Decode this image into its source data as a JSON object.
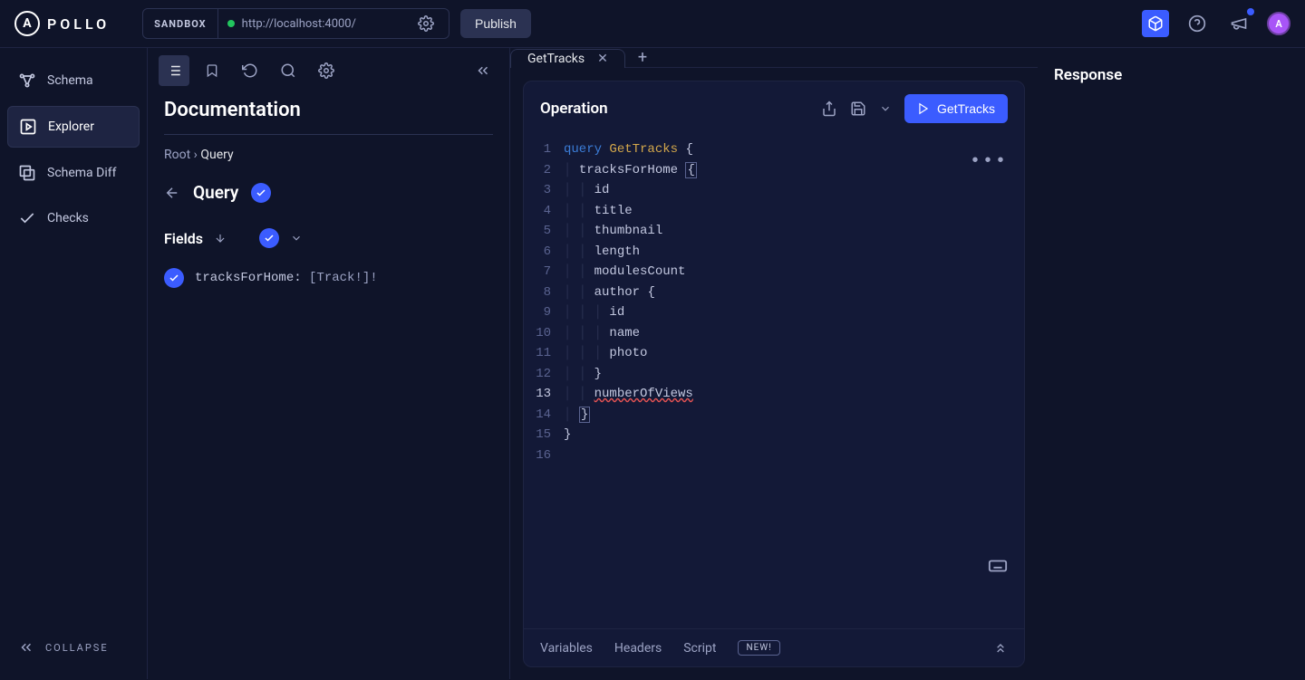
{
  "header": {
    "sandbox_label": "SANDBOX",
    "url": "http://localhost:4000/",
    "publish_label": "Publish",
    "avatar_initial": "A"
  },
  "sidebar": {
    "items": [
      {
        "label": "Schema"
      },
      {
        "label": "Explorer"
      },
      {
        "label": "Schema Diff"
      },
      {
        "label": "Checks"
      }
    ],
    "collapse_label": "COLLAPSE"
  },
  "doc": {
    "title": "Documentation",
    "breadcrumb_root": "Root",
    "breadcrumb_current": "Query",
    "query_label": "Query",
    "fields_label": "Fields",
    "field_name": "tracksForHome:",
    "field_type": "[Track!]!"
  },
  "editor": {
    "tab_name": "GetTracks",
    "operation_label": "Operation",
    "run_label": "GetTracks",
    "code": {
      "l1_kw": "query",
      "l1_name": "GetTracks",
      "l2": "tracksForHome",
      "l3": "id",
      "l4": "title",
      "l5": "thumbnail",
      "l6": "length",
      "l7": "modulesCount",
      "l8": "author",
      "l9": "id",
      "l10": "name",
      "l11": "photo",
      "l13": "numberOfViews"
    },
    "bottom": {
      "variables": "Variables",
      "headers": "Headers",
      "script": "Script",
      "new_badge": "NEW!"
    }
  },
  "response": {
    "title": "Response"
  }
}
